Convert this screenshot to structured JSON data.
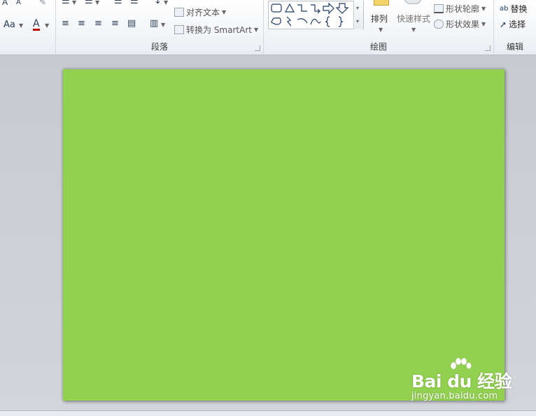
{
  "ribbon": {
    "paragraph": {
      "label": "段落",
      "align_text": "对齐文本",
      "convert_smartart": "转换为 SmartArt"
    },
    "font": {
      "change_case": "Aa",
      "font_color": "A"
    },
    "drawing": {
      "label": "绘图",
      "arrange": "排列",
      "quick_styles": "快速样式",
      "shape_outline": "形状轮廓",
      "shape_effects": "形状效果"
    },
    "editing": {
      "label": "编辑",
      "replace": "替换",
      "select": "选择"
    }
  },
  "slide": {
    "background_color": "#92d050"
  },
  "watermark": {
    "logo": "Bai du 经验",
    "url": "jingyan.baidu.com"
  }
}
